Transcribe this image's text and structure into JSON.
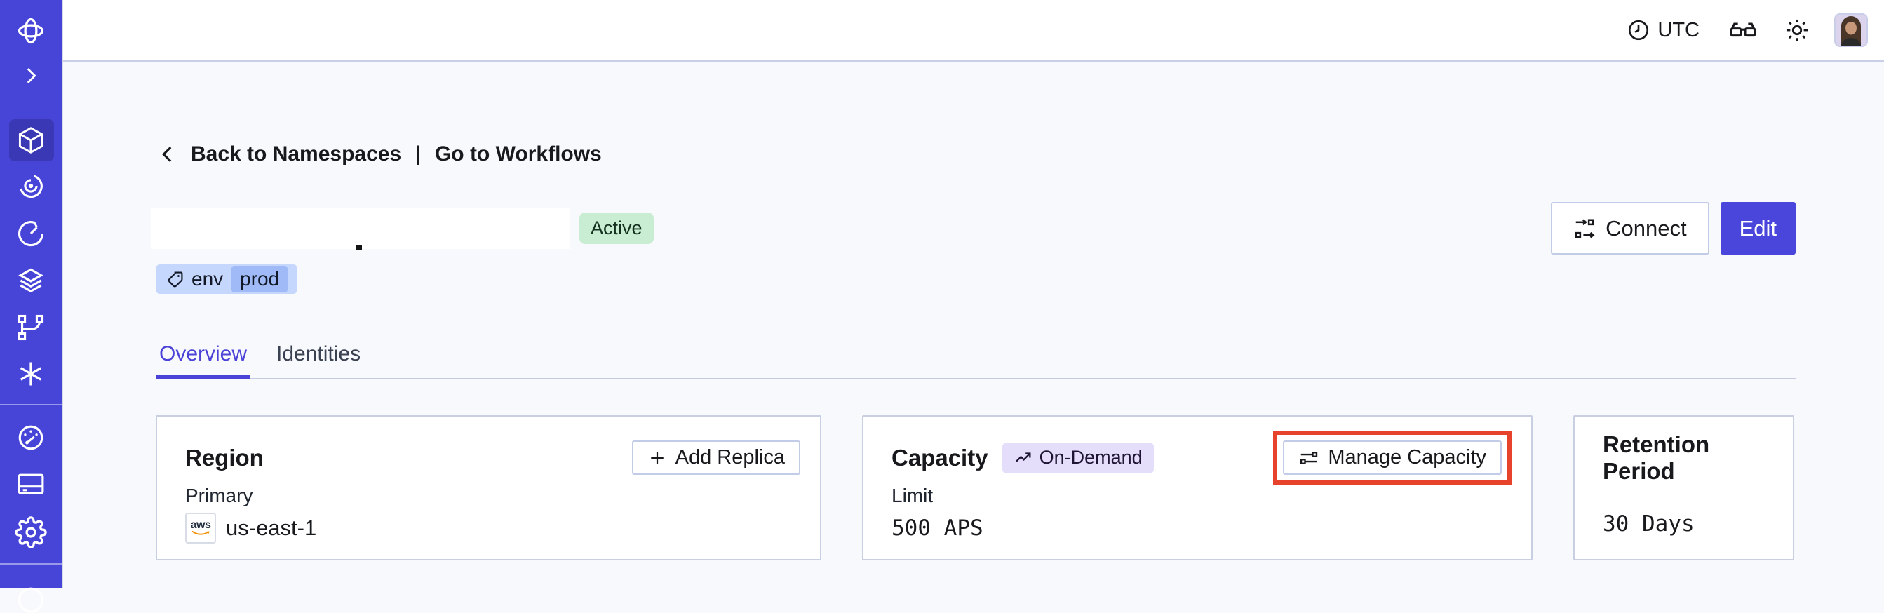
{
  "topbar": {
    "timezone_label": "UTC",
    "icons": [
      "clock-icon",
      "labs-glasses-icon",
      "theme-sun-icon",
      "user-avatar"
    ]
  },
  "sidebar": {
    "items": [
      {
        "name": "temporal-logo"
      },
      {
        "name": "expand-chevron"
      },
      {
        "name": "namespaces",
        "active": true
      },
      {
        "name": "workflows"
      },
      {
        "name": "schedules"
      },
      {
        "name": "deployments"
      },
      {
        "name": "batch-operations"
      },
      {
        "name": "nexus"
      },
      {
        "name": "usage"
      },
      {
        "name": "billing"
      },
      {
        "name": "settings"
      },
      {
        "name": "help"
      }
    ]
  },
  "breadcrumb": {
    "back_label": "Back to Namespaces",
    "separator": "|",
    "workflows_label": "Go to Workflows"
  },
  "namespace_header": {
    "status_badge": "Active",
    "tag": {
      "key": "env",
      "value": "prod"
    },
    "connect_label": "Connect",
    "edit_label": "Edit"
  },
  "tabs": [
    {
      "label": "Overview",
      "active": true
    },
    {
      "label": "Identities",
      "active": false
    }
  ],
  "cards": {
    "region": {
      "title": "Region",
      "action_label": "Add Replica",
      "label": "Primary",
      "provider": "aws",
      "value": "us-east-1"
    },
    "capacity": {
      "title": "Capacity",
      "badge": "On-Demand",
      "action_label": "Manage Capacity",
      "label": "Limit",
      "value": "500 APS",
      "action_highlighted": true
    },
    "retention": {
      "title": "Retention Period",
      "value": "30 Days"
    }
  },
  "colors": {
    "sidebar_bg": "#4744D8",
    "accent": "#4B46DB",
    "active_badge_bg": "#C9EDD3",
    "tag_bg": "#C5D7FC",
    "tag_chip_bg": "#9FBAF7",
    "ondemand_badge_bg": "#E5DEFB",
    "highlight_box": "#E7432C"
  }
}
